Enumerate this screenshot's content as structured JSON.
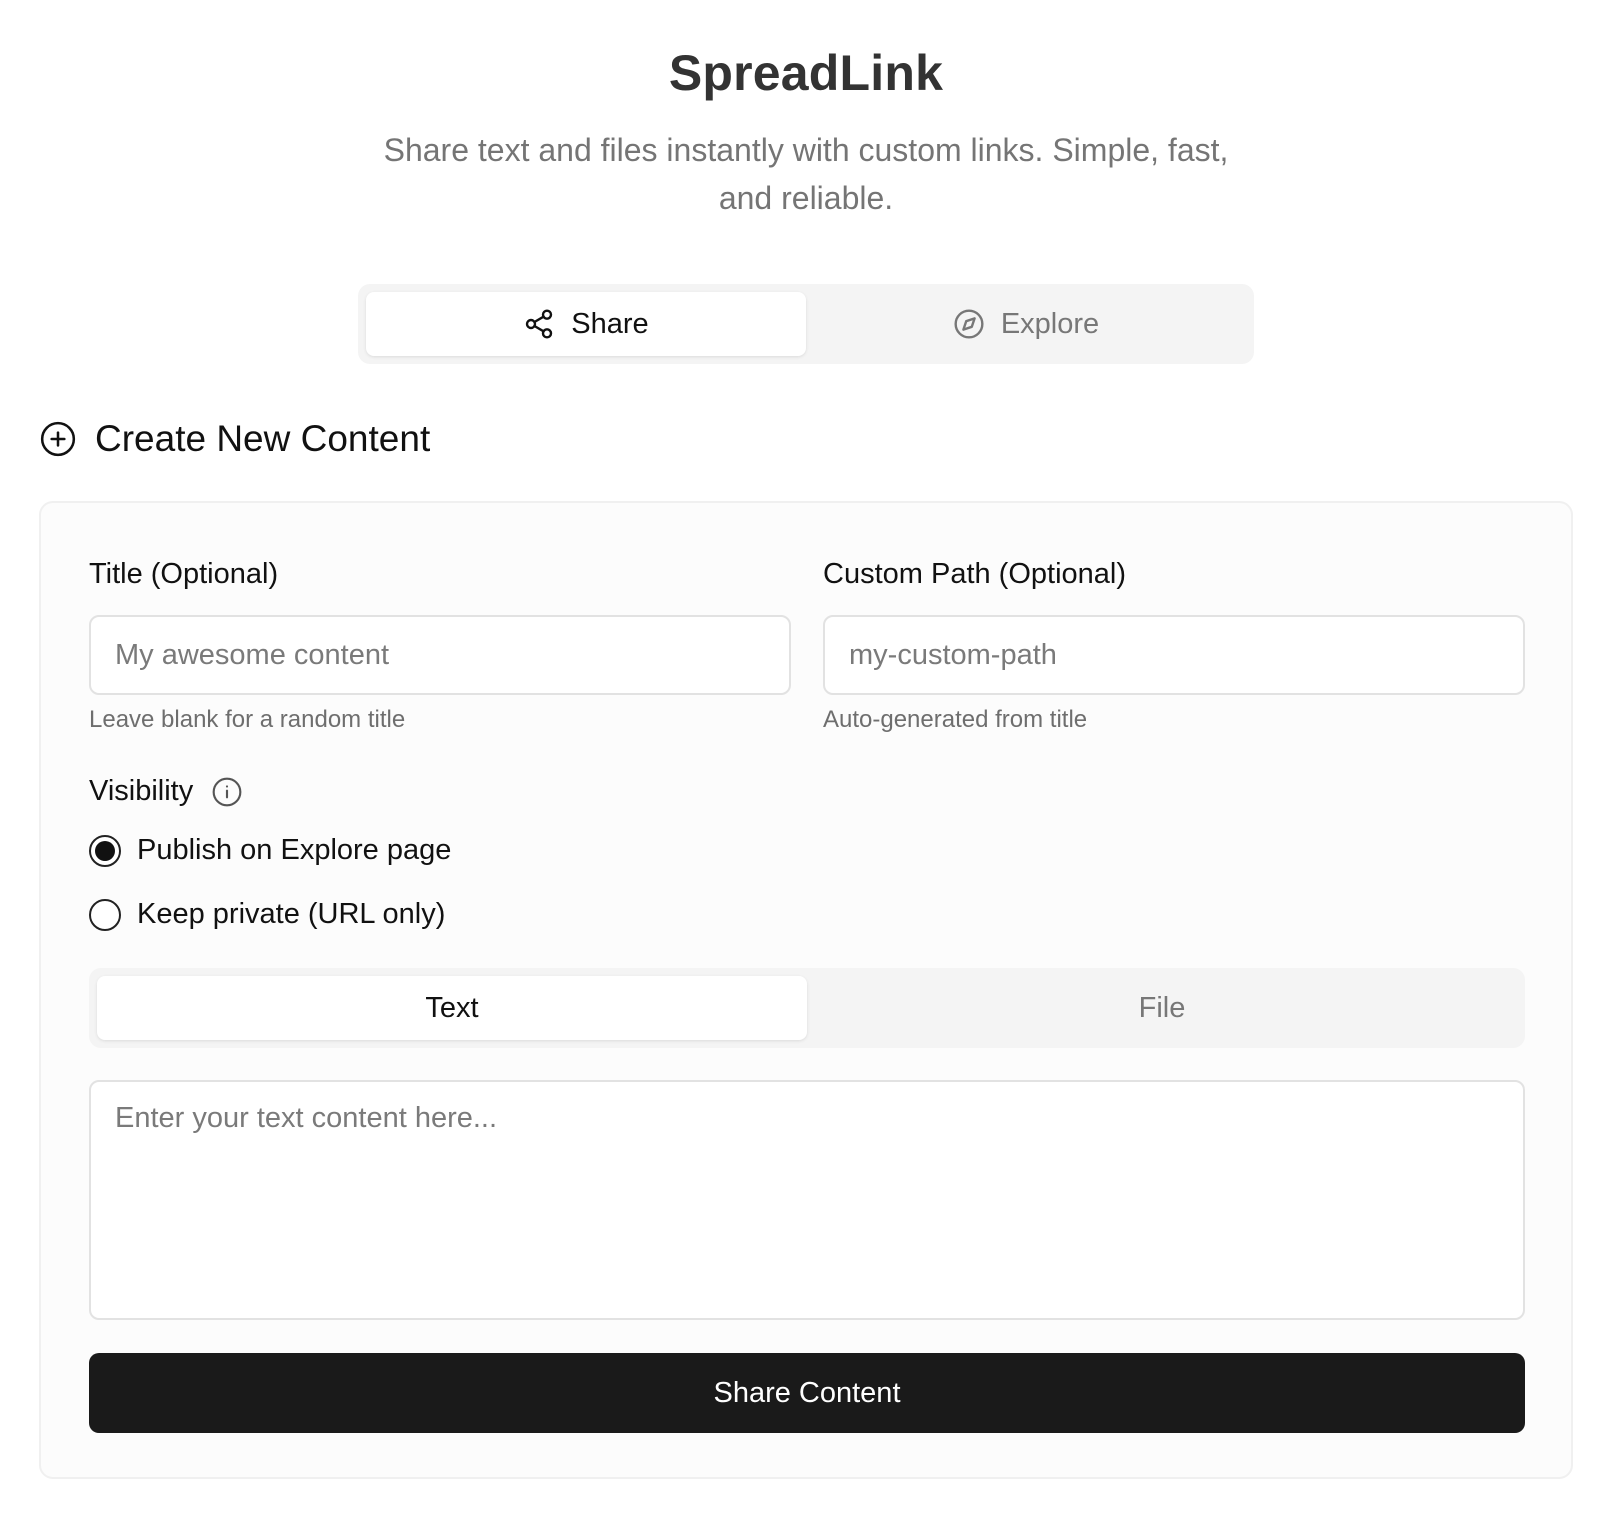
{
  "header": {
    "title": "SpreadLink",
    "subtitle": "Share text and files instantly with custom links. Simple, fast, and reliable."
  },
  "main_tabs": [
    {
      "label": "Share",
      "icon": "share-icon",
      "active": true
    },
    {
      "label": "Explore",
      "icon": "compass-icon",
      "active": false
    }
  ],
  "section": {
    "heading": "Create New Content",
    "icon": "plus-circle-icon"
  },
  "form": {
    "title_field": {
      "label": "Title (Optional)",
      "placeholder": "My awesome content",
      "value": "",
      "helper": "Leave blank for a random title"
    },
    "path_field": {
      "label": "Custom Path (Optional)",
      "placeholder": "my-custom-path",
      "value": "",
      "helper": "Auto-generated from title"
    },
    "visibility": {
      "label": "Visibility",
      "icon": "info-icon",
      "options": [
        {
          "label": "Publish on Explore page",
          "selected": true
        },
        {
          "label": "Keep private (URL only)",
          "selected": false
        }
      ]
    },
    "content_tabs": [
      {
        "label": "Text",
        "active": true
      },
      {
        "label": "File",
        "active": false
      }
    ],
    "text_content": {
      "placeholder": "Enter your text content here...",
      "value": ""
    },
    "submit_label": "Share Content"
  },
  "colors": {
    "primary_button": "#1a1a1a",
    "tab_track": "#f4f4f4",
    "muted_text": "#757575"
  }
}
